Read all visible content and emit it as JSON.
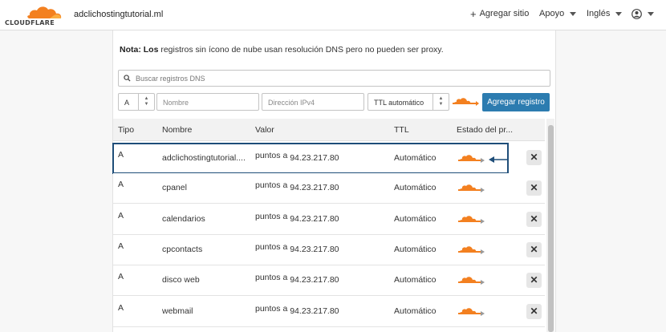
{
  "brand": {
    "logo_text": "CLOUDFLARE",
    "accent": "#f38020"
  },
  "header": {
    "domain": "adclichostingtutorial.ml",
    "add_site": "Agregar sitio",
    "support": "Apoyo",
    "language": "Inglés"
  },
  "note": {
    "bold": "Nota: Los",
    "text": " registros sin ícono de nube usan resolución DNS pero no pueden ser proxy."
  },
  "search": {
    "placeholder": "Buscar registros DNS"
  },
  "form": {
    "type_value": "A",
    "name_placeholder": "Nombre",
    "ipv4_placeholder": "Dirección IPv4",
    "ttl_value": "TTL automático",
    "add_button": "Agregar registro"
  },
  "table": {
    "columns": [
      "Tipo",
      "Nombre",
      "Valor",
      "TTL",
      "Estado del pr..."
    ],
    "rows": [
      {
        "type": "A",
        "name": "adclichostingtutorial....",
        "value_prefix": "puntos a",
        "ip": "94.23.217.80",
        "ttl": "Automático",
        "proxy_icon": "orange-cloud-proxy-icon"
      },
      {
        "type": "A",
        "name": "cpanel",
        "value_prefix": "puntos a",
        "ip": "94.23.217.80",
        "ttl": "Automático",
        "proxy_icon": "orange-cloud-proxy-icon"
      },
      {
        "type": "A",
        "name": "calendarios",
        "value_prefix": "puntos a",
        "ip": "94.23.217.80",
        "ttl": "Automático",
        "proxy_icon": "orange-cloud-proxy-icon"
      },
      {
        "type": "A",
        "name": "cpcontacts",
        "value_prefix": "puntos a",
        "ip": "94.23.217.80",
        "ttl": "Automático",
        "proxy_icon": "orange-cloud-proxy-icon"
      },
      {
        "type": "A",
        "name": "disco web",
        "value_prefix": "puntos a",
        "ip": "94.23.217.80",
        "ttl": "Automático",
        "proxy_icon": "orange-cloud-proxy-icon"
      },
      {
        "type": "A",
        "name": "webmail",
        "value_prefix": "puntos a",
        "ip": "94.23.217.80",
        "ttl": "Automático",
        "proxy_icon": "orange-cloud-proxy-icon"
      }
    ]
  },
  "colors": {
    "button_blue": "#2c7cb0",
    "highlight": "#1f4e79",
    "cloud_orange": "#f38020"
  }
}
